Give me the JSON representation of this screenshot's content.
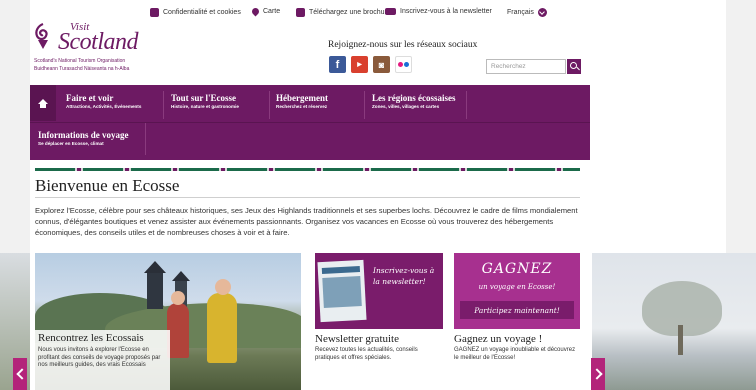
{
  "utility_bar": {
    "privacy": "Confidentialité et cookies",
    "map": "Carte",
    "brochure": "Téléchargez une brochure",
    "newsletter": "Inscrivez-vous à la newsletter",
    "language": "Français"
  },
  "logo": {
    "visit": "Visit",
    "scotland": "Scotland",
    "org_en": "Scotland's National Tourism Organisation",
    "org_gd": "Buidheann Turasachd Nàiseanta na h-Alba"
  },
  "social": {
    "title": "Rejoignez-nous sur les réseaux sociaux",
    "icons": [
      "facebook-icon",
      "youtube-icon",
      "instagram-icon",
      "flickr-icon"
    ]
  },
  "search": {
    "placeholder": "Recherchez"
  },
  "nav": {
    "items": [
      {
        "title": "Faire et voir",
        "sub": "Attractions, Activités, Événements"
      },
      {
        "title": "Tout sur l'Ecosse",
        "sub": "Histoire, nature et gastronomie"
      },
      {
        "title": "Hébergement",
        "sub": "Recherchez et réservez"
      },
      {
        "title": "Les régions écossaises",
        "sub": "Zones, villes, villages et cartes"
      },
      {
        "title": "Informations de voyage",
        "sub": "Se déplacer en Ecosse, climat"
      }
    ]
  },
  "welcome": {
    "title": "Bienvenue en Ecosse",
    "intro": "Explorez l'Ecosse, célèbre pour ses châteaux historiques, ses Jeux des Highlands traditionnels et ses superbes lochs. Découvrez le cadre de films mondialement connus, d'élégantes boutiques et venez assister aux événements passionnants. Organisez vos vacances en Ecosse où vous trouverez des hébergements économiques, des conseils utiles et de nombreuses choses à voir et à faire."
  },
  "cards": [
    {
      "title": "Rencontrez les Ecossais",
      "text": "Nous vous invitons à explorer l'Ecosse en profitant des conseils de voyage proposés par nos meilleurs guides, des vrais Ecossais"
    },
    {
      "title": "Newsletter gratuite",
      "text": "Recevez toutes les actualités, conseils pratiques et offres spéciales.",
      "image_text": "Inscrivez-vous à la newsletter!"
    },
    {
      "title": "Gagnez un voyage !",
      "text": "GAGNEZ un voyage inoubliable et découvrez le meilleur de l'Ecosse!",
      "image_big": "GAGNEZ",
      "image_mid": "un voyage en Ecosse!",
      "image_band": "Participez maintenant!"
    }
  ],
  "colors": {
    "brand_purple": "#6d1a63",
    "carousel_arrow": "#b3247a"
  }
}
